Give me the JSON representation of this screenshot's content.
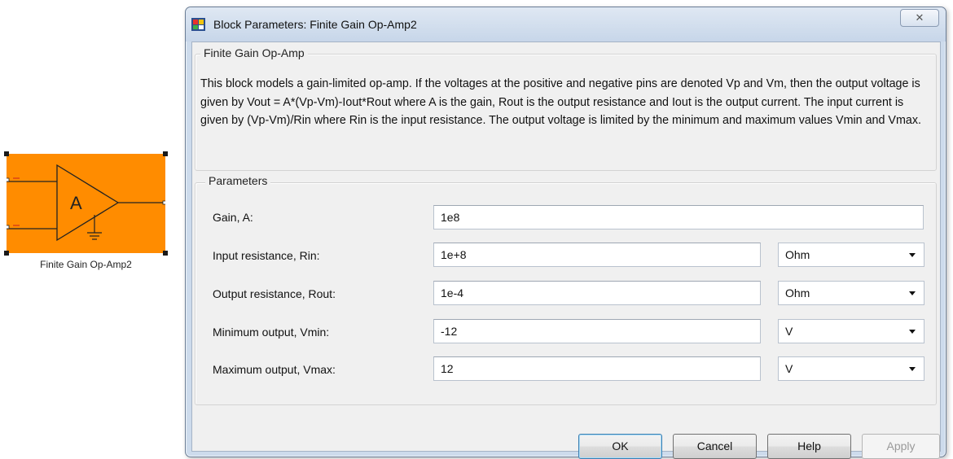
{
  "block": {
    "symbol": "A",
    "caption": "Finite Gain Op-Amp2",
    "fill_color": "#ff8c00"
  },
  "dialog": {
    "title": "Block Parameters: Finite Gain Op-Amp2",
    "close_glyph": "✕",
    "app_icon": "simulink-block-icon",
    "description_group": {
      "legend": "Finite Gain Op-Amp",
      "text": "This block models a gain-limited op-amp. If the voltages at the positive and negative pins are denoted Vp and Vm, then the output voltage is given by Vout = A*(Vp-Vm)-Iout*Rout where A is the gain, Rout is the output resistance and Iout is the output current. The input current is given by (Vp-Vm)/Rin where Rin is the input resistance. The output voltage is limited by the minimum and maximum values Vmin and Vmax."
    },
    "parameters": {
      "legend": "Parameters",
      "rows": [
        {
          "label": "Gain, A:",
          "value": "1e8"
        },
        {
          "label": "Input resistance, Rin:",
          "value": "1e+8",
          "unit": "Ohm"
        },
        {
          "label": "Output resistance, Rout:",
          "value": "1e-4",
          "unit": "Ohm"
        },
        {
          "label": "Minimum output, Vmin:",
          "value": "-12",
          "unit": "V"
        },
        {
          "label": "Maximum output, Vmax:",
          "value": "12",
          "unit": "V"
        }
      ]
    },
    "buttons": {
      "ok": "OK",
      "cancel": "Cancel",
      "help": "Help",
      "apply": "Apply"
    }
  }
}
